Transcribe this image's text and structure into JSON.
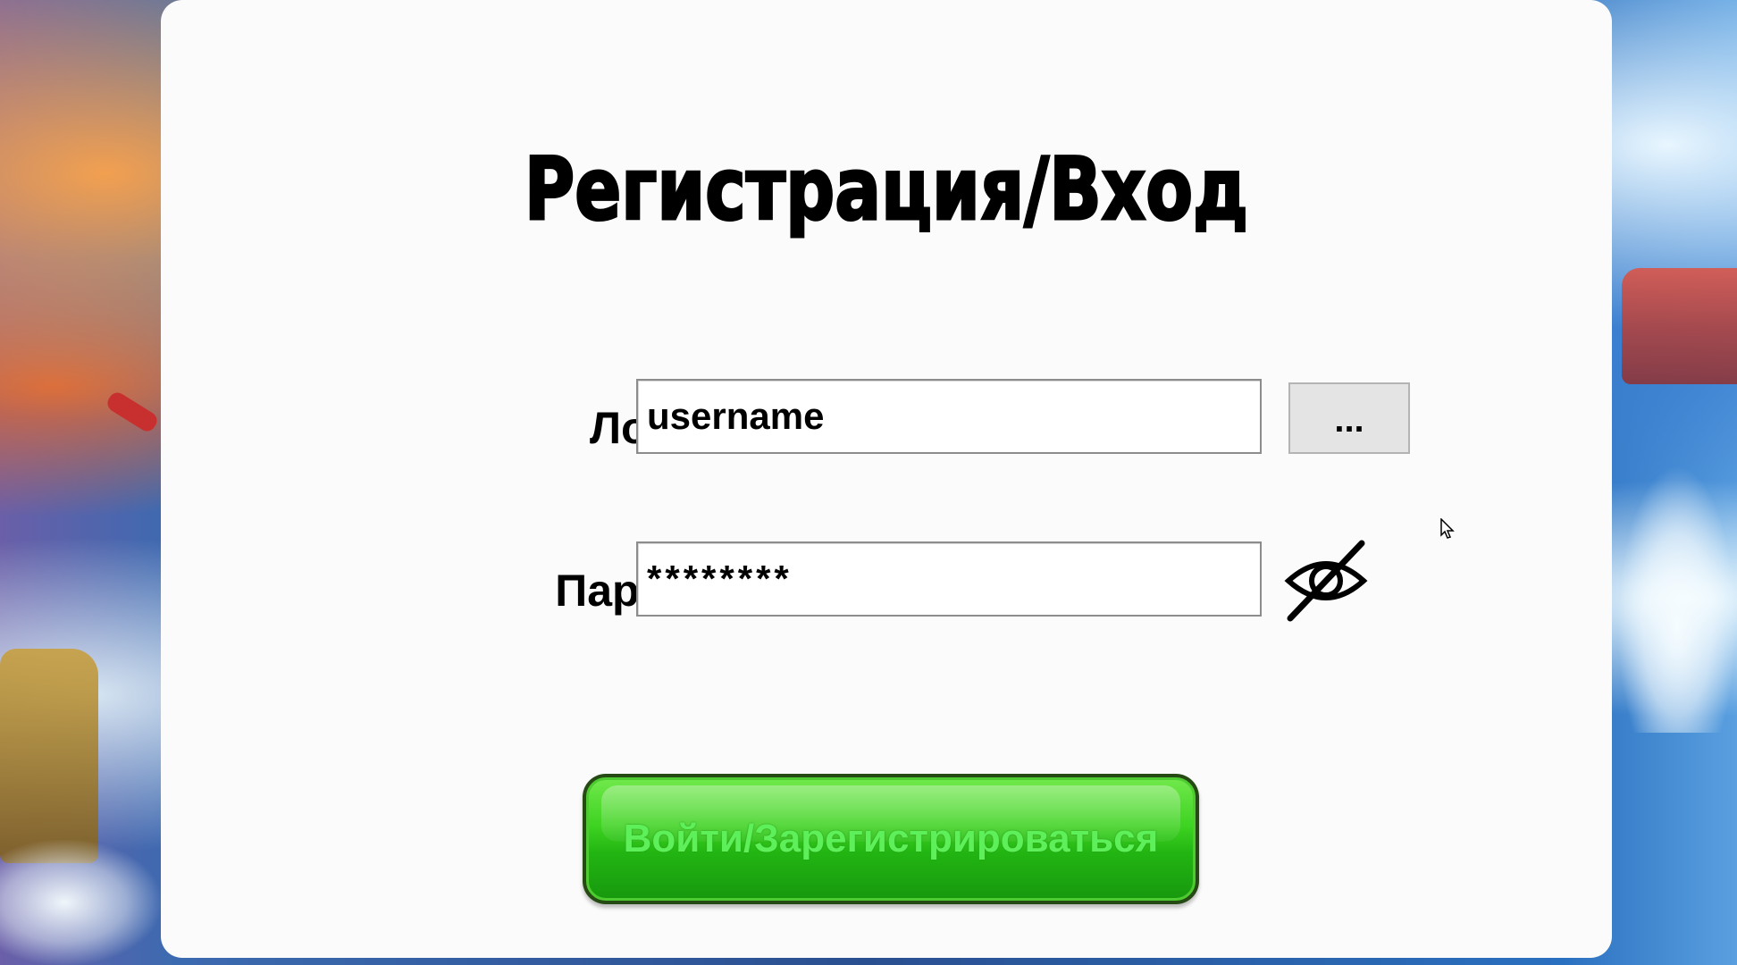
{
  "dialog": {
    "title": "Регистрация/Вход",
    "login_label": "Логин:",
    "login_value": "username",
    "password_label": "Пароль:",
    "password_value": "********",
    "browse_button_label": "...",
    "password_toggle_icon": "eye-slash-icon",
    "submit_label": "Войти/Зарегистрироваться"
  },
  "colors": {
    "panel_bg": "#fbfbfb",
    "submit_green": "#3fd322",
    "submit_text": "#5ef05a"
  }
}
